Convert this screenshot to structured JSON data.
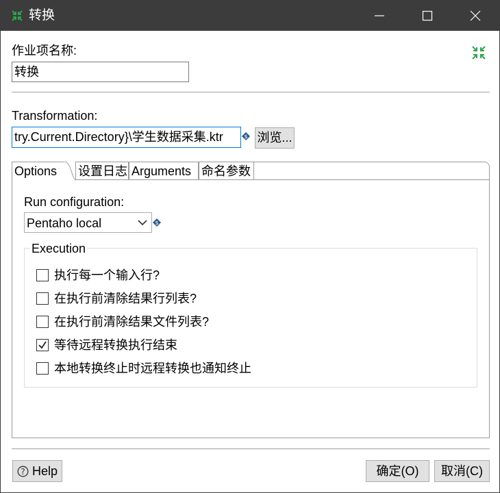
{
  "window": {
    "title": "转换",
    "icon": "kettle-transform-icon"
  },
  "job_entry": {
    "name_label": "作业项名称:",
    "name_value": "转换"
  },
  "transformation": {
    "label": "Transformation:",
    "path_value": "try.Current.Directory}\\学生数据采集.ktr",
    "browse_label": "浏览..."
  },
  "tabs": [
    {
      "label": "Options",
      "active": true
    },
    {
      "label": "设置日志",
      "active": false
    },
    {
      "label": "Arguments",
      "active": false
    },
    {
      "label": "命名参数",
      "active": false
    }
  ],
  "options": {
    "run_config_label": "Run configuration:",
    "run_config_value": "Pentaho local",
    "execution": {
      "title": "Execution",
      "checkboxes": [
        {
          "label": "执行每一个输入行?",
          "checked": false
        },
        {
          "label": "在执行前清除结果行列表?",
          "checked": false
        },
        {
          "label": "在执行前清除结果文件列表?",
          "checked": false
        },
        {
          "label": "等待远程转换执行结束",
          "checked": true
        },
        {
          "label": "本地转换终止时远程转换也通知终止",
          "checked": false
        }
      ]
    }
  },
  "footer": {
    "help_label": "Help",
    "ok_label": "确定(O)",
    "cancel_label": "取消(C)"
  },
  "colors": {
    "titlebar": "#3c3c3c",
    "accent_green": "#2ea44f",
    "focus_blue": "#0078d7",
    "variable_icon": "#2b5a8a"
  }
}
